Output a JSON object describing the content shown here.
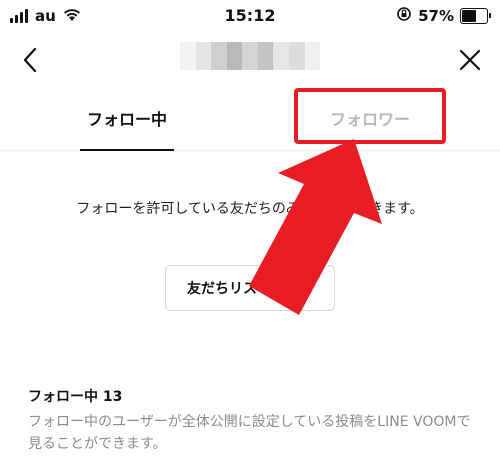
{
  "status_bar": {
    "carrier": "au",
    "time": "15:12",
    "battery_percent": "57%",
    "battery_level": 0.57,
    "icons": [
      "signal-icon",
      "wifi-icon",
      "orientation-lock-icon",
      "battery-icon"
    ]
  },
  "nav": {
    "back_icon": "chevron-left-icon",
    "close_icon": "close-icon",
    "title_blurred": true
  },
  "tabs": [
    {
      "label": "フォロー中",
      "active": true
    },
    {
      "label": "フォロワー",
      "active": false,
      "highlighted": true
    }
  ],
  "content": {
    "notice": "フォローを許可している友だちのみフォローできます。",
    "friends_list_button": "友だちリストを見る",
    "section_title": "フォロー中 13",
    "section_description": "フォロー中のユーザーが全体公開に設定している投稿をLINE VOOMで見ることができます。"
  },
  "annotation": {
    "highlight_color": "#ea1c24",
    "arrow_color": "#ea1c24",
    "arrow_icon": "red-pointer-arrow-icon"
  },
  "colors": {
    "text_primary": "#111111",
    "text_inactive": "#b7b7b7",
    "text_secondary": "#8c8c8c",
    "divider": "#e8e8e8"
  }
}
